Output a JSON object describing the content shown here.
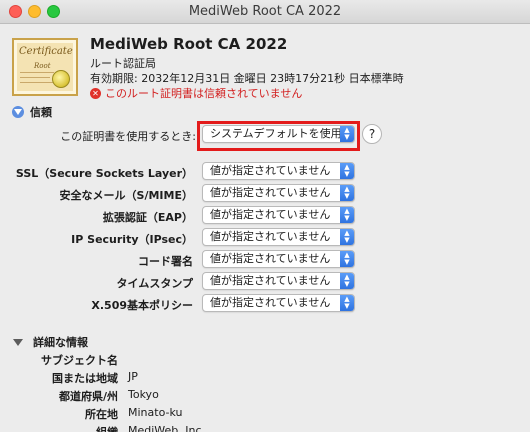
{
  "window": {
    "title": "MediWeb Root CA 2022"
  },
  "certificate": {
    "icon_text": "Certificate",
    "icon_sub": "Root",
    "name": "MediWeb Root CA 2022",
    "kind": "ルート認証局",
    "expiry": "有効期限: 2032年12月31日 金曜日 23時17分21秒 日本標準時",
    "warning": "このルート証明書は信頼されていません"
  },
  "trust": {
    "section_label": "信頼",
    "when_using_label": "この証明書を使用するとき:",
    "when_using_value": "システムデフォルトを使用",
    "help_label": "?",
    "rows": [
      {
        "label": "SSL（Secure Sockets Layer）",
        "value": "値が指定されていません"
      },
      {
        "label": "安全なメール（S/MIME）",
        "value": "値が指定されていません"
      },
      {
        "label": "拡張認証（EAP）",
        "value": "値が指定されていません"
      },
      {
        "label": "IP Security（IPsec）",
        "value": "値が指定されていません"
      },
      {
        "label": "コード署名",
        "value": "値が指定されていません"
      },
      {
        "label": "タイムスタンプ",
        "value": "値が指定されていません"
      },
      {
        "label": "X.509基本ポリシー",
        "value": "値が指定されていません"
      }
    ]
  },
  "details": {
    "section_label": "詳細な情報",
    "subject_label": "サブジェクト名",
    "fields": [
      {
        "label": "国または地域",
        "value": "JP"
      },
      {
        "label": "都道府県/州",
        "value": "Tokyo"
      },
      {
        "label": "所在地",
        "value": "Minato-ku"
      },
      {
        "label": "組織",
        "value": "MediWeb, Inc."
      }
    ]
  },
  "colors": {
    "warning": "#d21f1f",
    "highlight": "#e31b1b",
    "select_accent": "#2f73e0"
  }
}
